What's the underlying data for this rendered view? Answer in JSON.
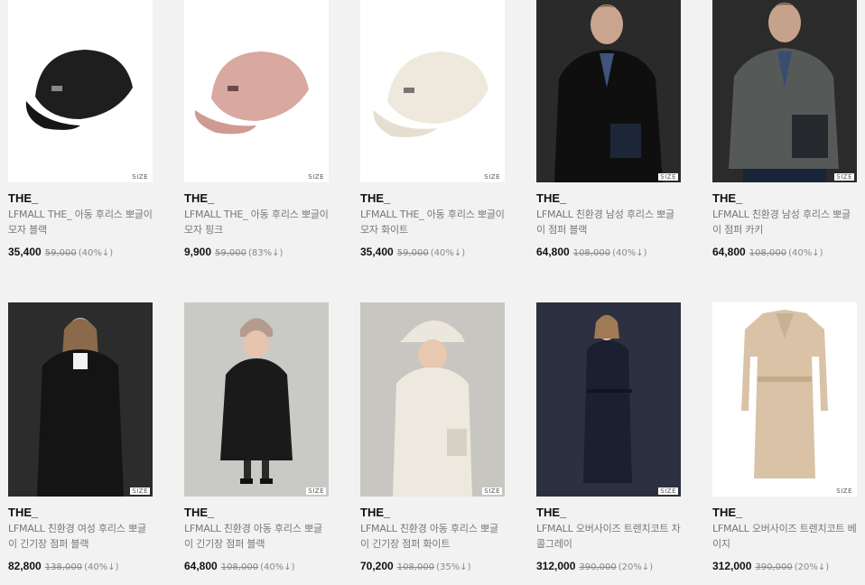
{
  "products": [
    {
      "brand": "THE_",
      "title": "LFMALL THE_ 아동 후리스 뽀글이 모자 블랙",
      "price": "35,400",
      "original_price": "59,000",
      "discount": "(40%↓)",
      "size_label": "SIZE",
      "image": "black-fleece-cap"
    },
    {
      "brand": "THE_",
      "title": "LFMALL THE_ 아동 후리스 뽀글이 모자 핑크",
      "price": "9,900",
      "original_price": "59,000",
      "discount": "(83%↓)",
      "size_label": "SIZE",
      "image": "pink-fleece-cap"
    },
    {
      "brand": "THE_",
      "title": "LFMALL THE_ 아동 후리스 뽀글이 모자 화이트",
      "price": "35,400",
      "original_price": "59,000",
      "discount": "(40%↓)",
      "size_label": "SIZE",
      "image": "white-fleece-cap"
    },
    {
      "brand": "THE_",
      "title": "LFMALL 친환경 남성 후리스 뽀글이 점퍼 블랙",
      "price": "64,800",
      "original_price": "108,000",
      "discount": "(40%↓)",
      "size_label": "SIZE",
      "image": "man-black-fleece-jacket"
    },
    {
      "brand": "THE_",
      "title": "LFMALL 친환경 남성 후리스 뽀글이 점퍼 카키",
      "price": "64,800",
      "original_price": "108,000",
      "discount": "(40%↓)",
      "size_label": "SIZE",
      "image": "man-khaki-fleece-jacket"
    },
    {
      "brand": "THE_",
      "title": "LFMALL 친환경 여성 후리스 뽀글이 긴기장 점퍼 블랙",
      "price": "82,800",
      "original_price": "138,000",
      "discount": "(40%↓)",
      "size_label": "SIZE",
      "image": "woman-black-long-fleece"
    },
    {
      "brand": "THE_",
      "title": "LFMALL 친환경 아동 후리스 뽀글이 긴기장 점퍼 블랙",
      "price": "64,800",
      "original_price": "108,000",
      "discount": "(40%↓)",
      "size_label": "SIZE",
      "image": "girl-black-long-fleece"
    },
    {
      "brand": "THE_",
      "title": "LFMALL 친환경 아동 후리스 뽀글이 긴기장 점퍼 화이트",
      "price": "70,200",
      "original_price": "108,000",
      "discount": "(35%↓)",
      "size_label": "SIZE",
      "image": "boy-white-long-fleece"
    },
    {
      "brand": "THE_",
      "title": "LFMALL 오버사이즈 트렌치코트 차콜그레이",
      "price": "312,000",
      "original_price": "390,000",
      "discount": "(20%↓)",
      "size_label": "SIZE",
      "image": "woman-charcoal-trench"
    },
    {
      "brand": "THE_",
      "title": "LFMALL 오버사이즈 트렌치코트 베이지",
      "price": "312,000",
      "original_price": "390,000",
      "discount": "(20%↓)",
      "size_label": "SIZE",
      "image": "beige-trench-coat"
    }
  ],
  "colors": {
    "card_bg": "#ffffff",
    "page_bg": "#f2f2f2",
    "price": "#111111",
    "muted": "#888888"
  }
}
